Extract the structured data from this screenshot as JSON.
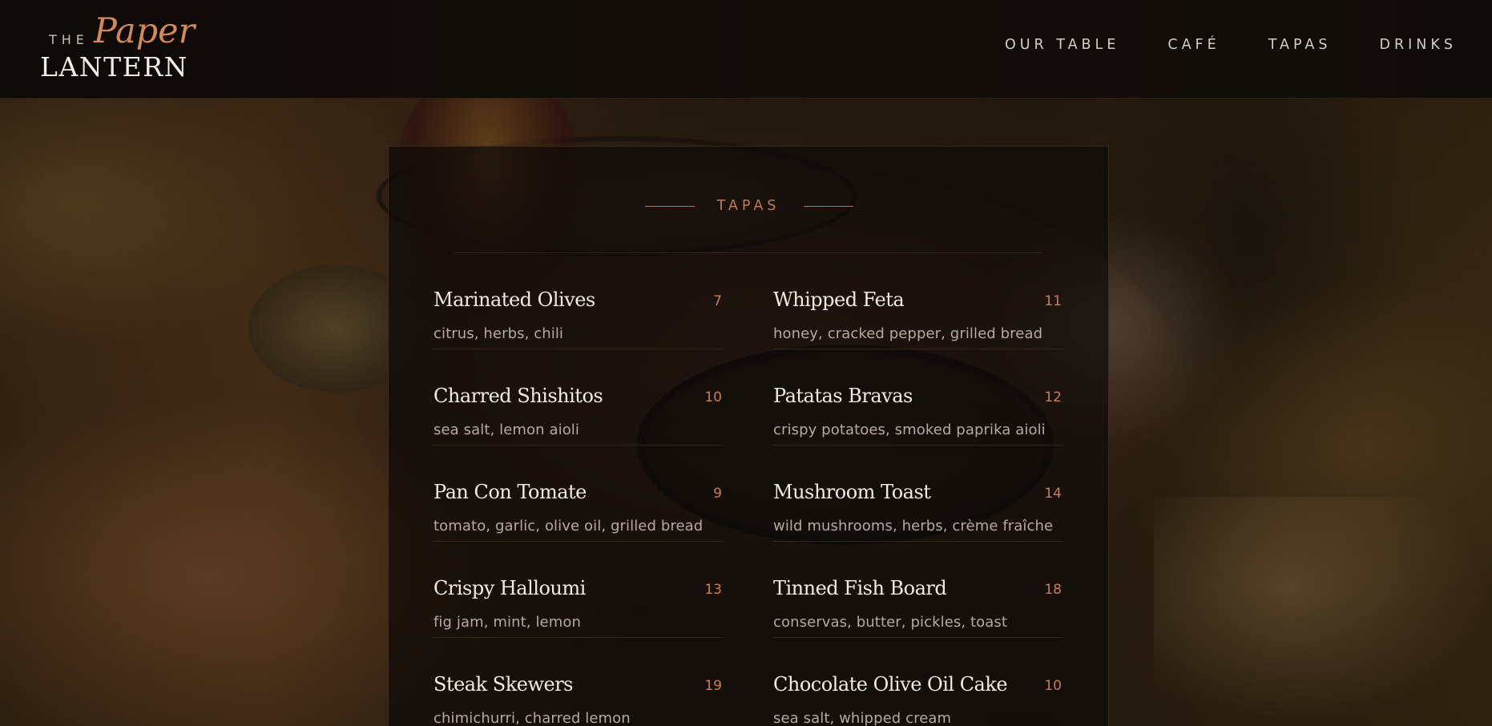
{
  "brand": {
    "the": "THE",
    "paper": "Paper",
    "lantern": "LANTERN"
  },
  "nav": {
    "items": [
      {
        "label": "OUR TABLE"
      },
      {
        "label": "CAFÉ"
      },
      {
        "label": "TAPAS"
      },
      {
        "label": "DRINKS"
      }
    ]
  },
  "menu": {
    "section_title": "TAPAS",
    "left": [
      {
        "name": "Marinated Olives",
        "price": "7",
        "desc": "citrus, herbs, chili"
      },
      {
        "name": "Charred Shishitos",
        "price": "10",
        "desc": "sea salt, lemon aioli"
      },
      {
        "name": "Pan Con Tomate",
        "price": "9",
        "desc": "tomato, garlic, olive oil, grilled bread"
      },
      {
        "name": "Crispy Halloumi",
        "price": "13",
        "desc": "fig jam, mint, lemon"
      },
      {
        "name": "Steak Skewers",
        "price": "19",
        "desc": "chimichurri, charred lemon"
      }
    ],
    "right": [
      {
        "name": "Whipped Feta",
        "price": "11",
        "desc": "honey, cracked pepper, grilled bread"
      },
      {
        "name": "Patatas Bravas",
        "price": "12",
        "desc": "crispy potatoes, smoked paprika aioli"
      },
      {
        "name": "Mushroom Toast",
        "price": "14",
        "desc": "wild mushrooms, herbs, crème fraîche"
      },
      {
        "name": "Tinned Fish Board",
        "price": "18",
        "desc": "conservas, butter, pickles, toast"
      },
      {
        "name": "Chocolate Olive Oil Cake",
        "price": "10",
        "desc": "sea salt, whipped cream"
      }
    ]
  },
  "colors": {
    "accent": "#c47a4a",
    "text_light": "#f2ebe2",
    "text_muted": "#b3aaa0",
    "header_bg": "#0e0a07"
  }
}
